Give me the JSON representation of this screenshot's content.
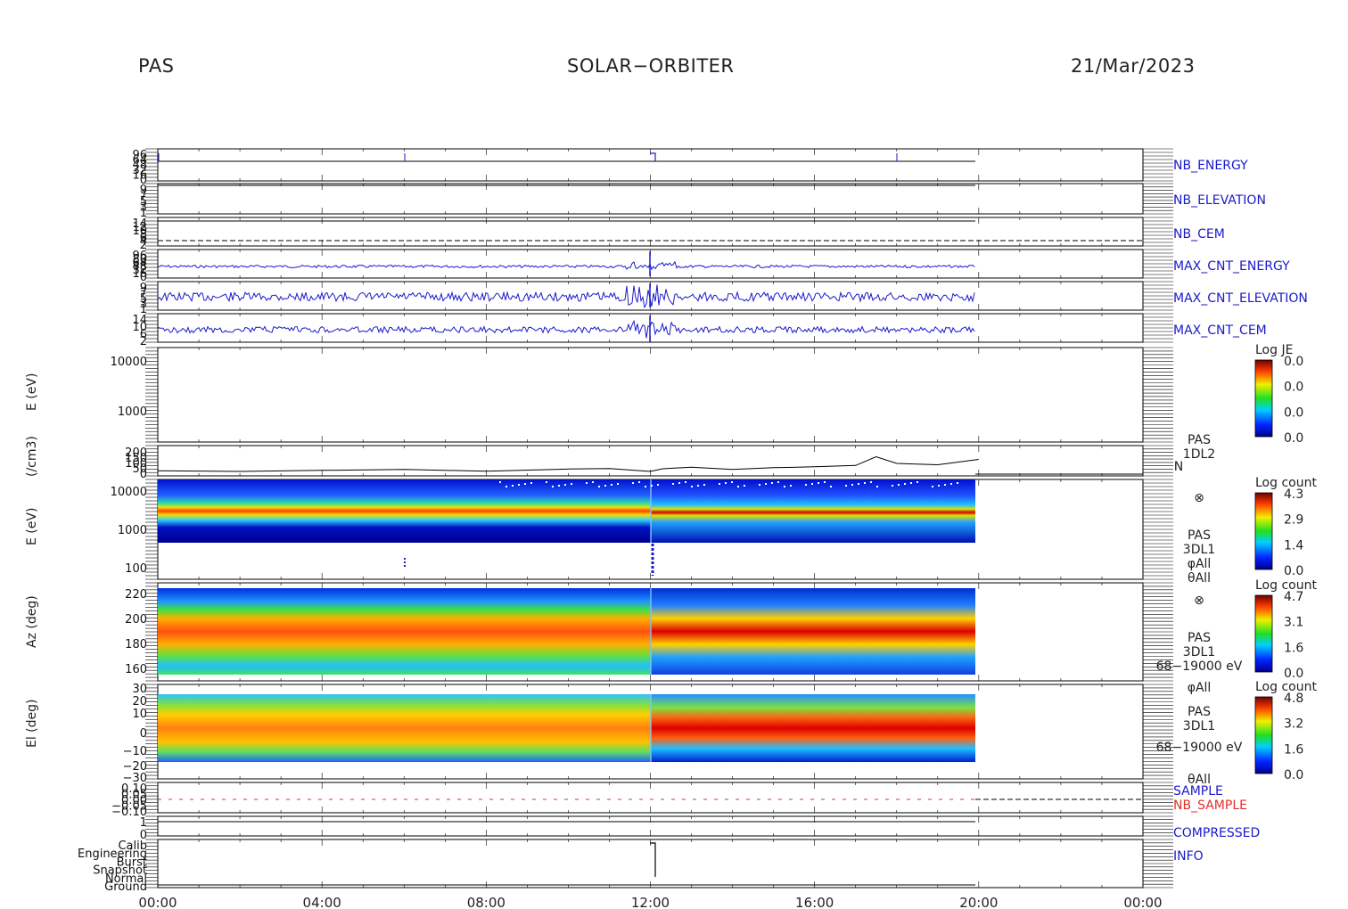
{
  "header": {
    "instrument": "PAS",
    "mission": "SOLAR−ORBITER",
    "date": "21/Mar/2023"
  },
  "colors": {
    "blue": "#1a1acc",
    "red": "#e0302a",
    "black": "#000000"
  },
  "chart_data": {
    "type": "heatmap",
    "time_axis": {
      "ticks": [
        "00:00",
        "04:00",
        "08:00",
        "12:00",
        "16:00",
        "20:00",
        "00:00"
      ],
      "data_end": "20:00"
    },
    "panels": [
      {
        "id": "nb_energy",
        "label": "NB_ENERGY",
        "color": "#1a1acc",
        "yticks": [
          "96",
          "64",
          "48",
          "32",
          "16",
          "0"
        ],
        "series": [
          {
            "x": [
              0,
              6,
              12,
              12.1,
              18,
              20
            ],
            "y": [
              96,
              0,
              96,
              0,
              40,
              0
            ]
          }
        ]
      },
      {
        "id": "nb_elevation",
        "label": "NB_ELEVATION",
        "color": "#1a1acc",
        "yticks": [
          "9",
          "7",
          "5",
          "3",
          "1"
        ]
      },
      {
        "id": "nb_cem",
        "label": "NB_CEM",
        "color": "#1a1acc",
        "yticks": [
          "14",
          "12",
          "10",
          "8",
          "6",
          "4",
          "2"
        ]
      },
      {
        "id": "max_cnt_energy",
        "label": "MAX_CNT_ENERGY",
        "color": "#1a1acc",
        "yticks": [
          "96",
          "80",
          "64",
          "48",
          "32",
          "16",
          "0"
        ],
        "level": 0.55
      },
      {
        "id": "max_cnt_elevation",
        "label": "MAX_CNT_ELEVATION",
        "color": "#1a1acc",
        "yticks": [
          "9",
          "7",
          "5",
          "3",
          "1"
        ],
        "level": 0.55
      },
      {
        "id": "max_cnt_cem",
        "label": "MAX_CNT_CEM",
        "color": "#1a1acc",
        "yticks": [
          "14",
          "10",
          "6",
          "2"
        ],
        "level": 0.6
      },
      {
        "id": "je",
        "ylabel": "E (eV)",
        "yticks": [
          "10000",
          "1000"
        ],
        "colorbar": {
          "title": "Log JE",
          "ticks": [
            "0.0",
            "0.0",
            "0.0",
            "0.0"
          ]
        }
      },
      {
        "id": "density",
        "ylabel": "(/cm3)",
        "yticks": [
          "200",
          "150",
          "100",
          "50",
          "0"
        ],
        "side_text": [
          "PAS",
          "1DL2",
          "N"
        ],
        "series": [
          {
            "x": [
              0,
              2,
              4,
              6,
              8,
              10,
              11,
              12,
              12.3,
              13,
              14,
              15,
              16,
              17,
              17.5,
              18,
              19,
              20
            ],
            "y": [
              25,
              20,
              28,
              35,
              22,
              38,
              42,
              20,
              40,
              52,
              35,
              48,
              55,
              65,
              130,
              80,
              70,
              110
            ]
          }
        ]
      },
      {
        "id": "energy_spec",
        "ylabel": "E (eV)",
        "yticks": [
          "10000",
          "1000",
          "100"
        ],
        "side_text": [
          "⊗",
          "PAS",
          "3DL1",
          "φAll",
          "θAll"
        ],
        "colorbar": {
          "title": "Log count",
          "ticks": [
            "4.3",
            "2.9",
            "1.4",
            "0.0"
          ]
        }
      },
      {
        "id": "az",
        "ylabel": "Az (deg)",
        "yticks": [
          "220",
          "200",
          "180",
          "160"
        ],
        "side_text": [
          "⊗",
          "PAS",
          "3DL1",
          "68−19000 eV",
          "φAll"
        ],
        "colorbar": {
          "title": "Log count",
          "ticks": [
            "4.7",
            "3.1",
            "1.6",
            "0.0"
          ]
        }
      },
      {
        "id": "el",
        "ylabel": "El (deg)",
        "yticks": [
          "30",
          "20",
          "10",
          "0",
          "−10",
          "−20",
          "−30"
        ],
        "side_text": [
          "PAS",
          "3DL1",
          "68−19000 eV",
          "θAll"
        ],
        "colorbar": {
          "title": "Log count",
          "ticks": [
            "4.8",
            "3.2",
            "1.6",
            "0.0"
          ]
        }
      },
      {
        "id": "sample",
        "labels": [
          "SAMPLE",
          "NB_SAMPLE"
        ],
        "label_colors": [
          "#1a1acc",
          "#e0302a"
        ],
        "yticks": [
          "0.10",
          "0.05",
          "0.00",
          "−0.05",
          "−0.10"
        ]
      },
      {
        "id": "compressed",
        "label": "COMPRESSED",
        "color": "#1a1acc",
        "yticks": [
          "1",
          "0"
        ]
      },
      {
        "id": "info",
        "label": "INFO",
        "color": "#1a1acc",
        "yticks": [
          "Calib",
          "Engineering",
          "Burst",
          "Snapshot",
          "Normal",
          "Ground"
        ]
      }
    ]
  }
}
